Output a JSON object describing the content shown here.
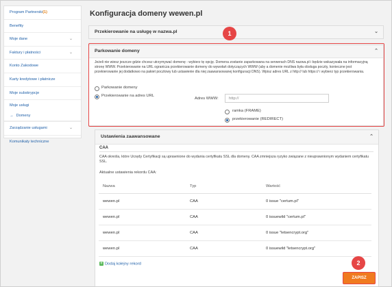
{
  "sidebar": {
    "items": [
      {
        "label": "Program Partnerski",
        "badge": "(1)"
      },
      {
        "label": "Benefity"
      },
      {
        "label": "Moje dane"
      },
      {
        "label": "Faktury i płatności"
      },
      {
        "label": "Konto Zakodowe"
      },
      {
        "label": "Karty kredytowe i płatnicze"
      },
      {
        "label": "Moje subskrypcje"
      },
      {
        "label": "Moje usługi"
      },
      {
        "label": "Domeny"
      },
      {
        "label": "Zarządzanie usługami"
      },
      {
        "label": "Komunikaty techniczne"
      }
    ]
  },
  "page": {
    "title": "Konfiguracja domeny wewen.pl"
  },
  "panel_redirect": {
    "title": "Przekierowanie na usługę w nazwa.pl"
  },
  "panel_parking": {
    "title": "Parkowanie domeny",
    "description": "Jeżeli nie wiesz jeszcze gdzie chcesz utrzymywać domenę - wybierz tę opcję. Domena zostanie zaparkowana na serwerach DNS nazwa.pl i będzie wskazywała na informacyjną stronę WWW. Przekierowanie na URL ogranicza przekierowanie domeny do wywołań dotyczących WWW (aby a domenie możliwa była obsługa poczty, konieczne jest przekierowanie jej dodatkowo na pakiet pocztowy lub ustawienie dla niej zaawansowanej konfiguracji DNS). Wpisz adres URL z http:// lub https:// i wybierz typ przekierowania.",
    "options": [
      "Parkowanie domeny",
      "Przekierowanie na adres URL"
    ],
    "www_label": "Adres WWW:",
    "www_value": "http://",
    "redirect_types": [
      "ramka (FRAME)",
      "przekierowanie (REDIRECT)"
    ]
  },
  "panel_advanced": {
    "title": "Ustawienia zaawansowane",
    "caa_heading": "CAA",
    "caa_description": "CAA określa, które Urzędy Certyfikacji są uprawnione do wydania certyfikatu SSL dla domeny. CAA zmniejsza ryzyko związane z nieuprawnionym wydaniem certyfikatu SSL.",
    "records_label": "Aktualne ustawienia rekordu CAA:",
    "columns": [
      "Nazwa",
      "Typ",
      "Wartość"
    ],
    "rows": [
      [
        "wewen.pl",
        "CAA",
        "0 issue \"certum.pl\""
      ],
      [
        "wewen.pl",
        "CAA",
        "0 issuewild \"certum.pl\""
      ],
      [
        "wewen.pl",
        "CAA",
        "0 issue \"letsencrypt.org\""
      ],
      [
        "wewen.pl",
        "CAA",
        "0 issuewild \"letsencrypt.org\""
      ]
    ],
    "add_label": "Dodaj kolejny rekord"
  },
  "save_label": "ZAPISZ",
  "annotations": [
    "1",
    "2"
  ],
  "colors": {
    "accent": "#1e5fa8",
    "highlight": "#e64646",
    "save": "#f07a1f"
  }
}
